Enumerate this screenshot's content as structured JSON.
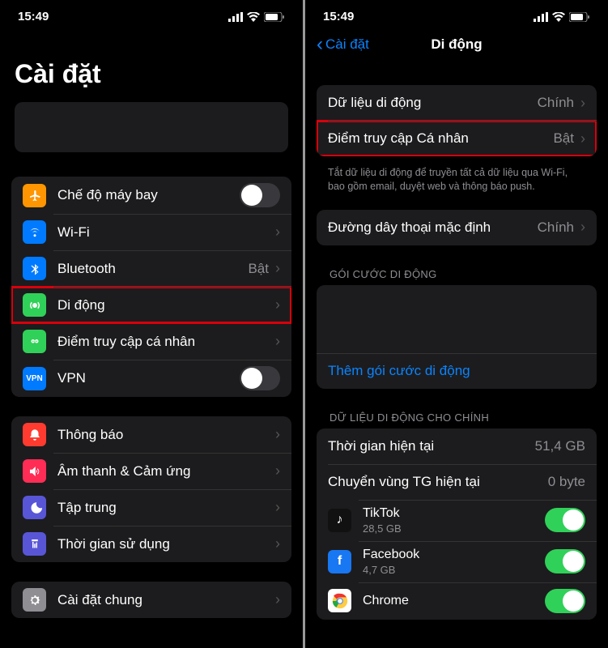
{
  "status": {
    "time": "15:49"
  },
  "left": {
    "title": "Cài đặt",
    "rows": {
      "airplane": "Chế độ máy bay",
      "wifi": "Wi-Fi",
      "bluetooth": "Bluetooth",
      "bluetooth_val": "Bật",
      "cellular": "Di động",
      "hotspot": "Điểm truy cập cá nhân",
      "vpn": "VPN",
      "notifications": "Thông báo",
      "sound": "Âm thanh & Cảm ứng",
      "focus": "Tập trung",
      "screentime": "Thời gian sử dụng",
      "general": "Cài đặt chung"
    }
  },
  "right": {
    "back": "Cài đặt",
    "title": "Di động",
    "rows": {
      "data": "Dữ liệu di động",
      "data_val": "Chính",
      "hotspot": "Điểm truy cập Cá nhân",
      "hotspot_val": "Bật",
      "footer": "Tắt dữ liệu di động để truyền tất cả dữ liệu qua Wi-Fi, bao gồm email, duyệt web và thông báo push.",
      "default_voice": "Đường dây thoại mặc định",
      "default_voice_val": "Chính",
      "plans_header": "Gói cước di động",
      "add_plan": "Thêm gói cước di động",
      "data_for_header": "Dữ liệu di động cho Chính",
      "current_period": "Thời gian hiện tại",
      "current_period_val": "51,4 GB",
      "roaming_period": "Chuyển vùng TG hiện tại",
      "roaming_period_val": "0 byte",
      "tiktok": "TikTok",
      "tiktok_val": "28,5 GB",
      "facebook": "Facebook",
      "facebook_val": "4,7 GB",
      "chrome": "Chrome"
    }
  }
}
